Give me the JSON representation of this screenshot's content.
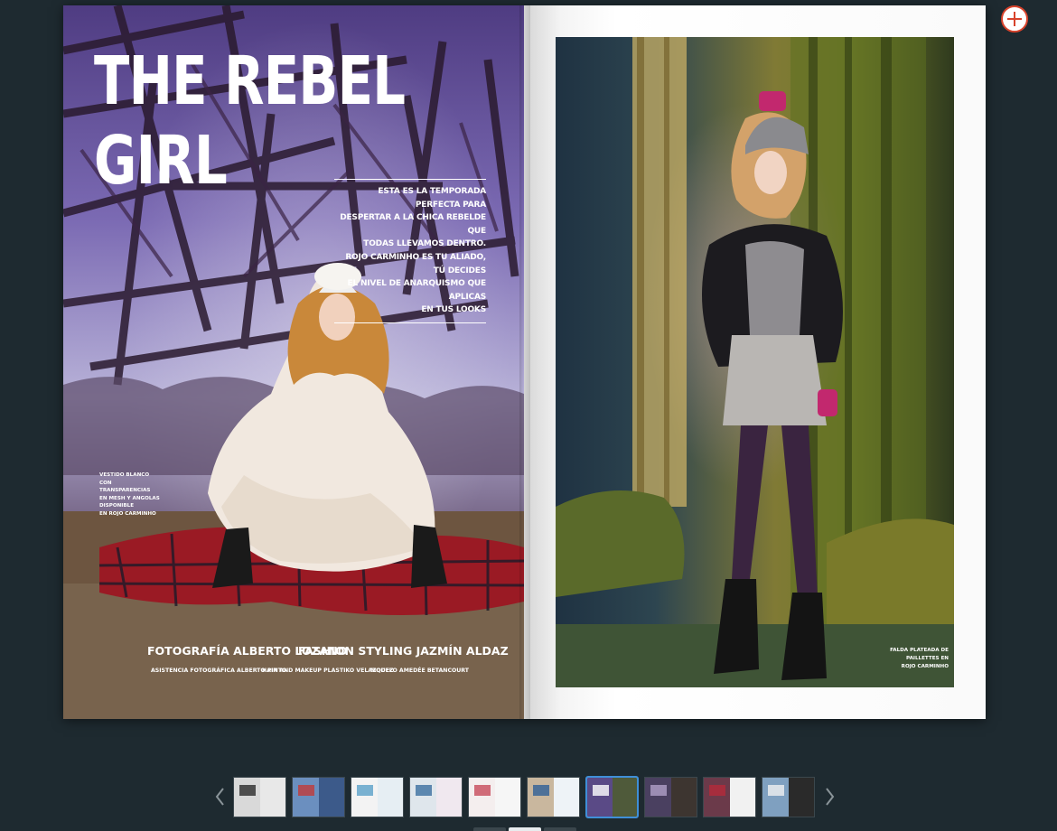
{
  "spread": {
    "title_line1": "THE REBEL",
    "title_line2": "GIRL",
    "intro_lines": [
      "ESTA ES LA TEMPORADA PERFECTA PARA",
      "DESPERTAR A LA CHICA REBELDE QUE",
      "TODAS LLEVAMOS DENTRO.",
      "ROJO CARMINHO ES TU ALIADO, TÚ DECIDES",
      "EL NIVEL DE ANARQUISMO QUE APLICAS",
      "EN TUS LOOKS"
    ],
    "left_caption_lines": [
      "VESTIDO BLANCO CON",
      "TRANSPARENCIAS",
      "EN MESH Y ANGOLAS",
      "DISPONIBLE",
      "EN ROJO CARMINHO"
    ],
    "credit_photo": "FOTOGRAFÍA ALBERTO LOZANO",
    "credit_styling": "FASHION STYLING JAZMÍN ALDAZ",
    "credit_assistant": "ASISTENCIA FOTOGRÁFICA ALBERTO PINTO",
    "credit_hair": "HAIR AND MAKEUP PLASTIKO VELAZQUEZ",
    "credit_model": "MODELO AMEDÉE BETANCOURT",
    "right_caption_lines": [
      "FALDA PLATEADA DE PAILLETTES EN",
      "ROJO CARMINHO"
    ]
  },
  "controls": {
    "zoom_icon": "zoom-in-plus-icon",
    "prev_icon": "chevron-left-icon",
    "next_icon": "chevron-right-icon"
  },
  "thumbnails": [
    {
      "left": "#d9d9d9",
      "right": "#e8e8e8",
      "accent": "#2b2b2b"
    },
    {
      "left": "#6b8fbf",
      "right": "#3c5a8a",
      "accent": "#c23a3a"
    },
    {
      "left": "#f3f3f3",
      "right": "#e6eef3",
      "accent": "#5aa0c8"
    },
    {
      "left": "#dfe6ec",
      "right": "#f0e8ef",
      "accent": "#3b6fa0"
    },
    {
      "left": "#f4eeee",
      "right": "#f6f6f6",
      "accent": "#c74a5a"
    },
    {
      "left": "#c9b79e",
      "right": "#eef3f7",
      "accent": "#2f5f96"
    },
    {
      "left": "#5a4a86",
      "right": "#4f5a3a",
      "accent": "#ffffff",
      "active": true
    },
    {
      "left": "#4a4060",
      "right": "#3d3530",
      "accent": "#b0a0c8"
    },
    {
      "left": "#6b3a4a",
      "right": "#f1f1f1",
      "accent": "#b52a3a"
    },
    {
      "left": "#7fa0c0",
      "right": "#2a2a2a",
      "accent": "#f0f0f0"
    }
  ],
  "colors": {
    "background": "#1e2a30",
    "active_border": "#3f8fd8"
  }
}
